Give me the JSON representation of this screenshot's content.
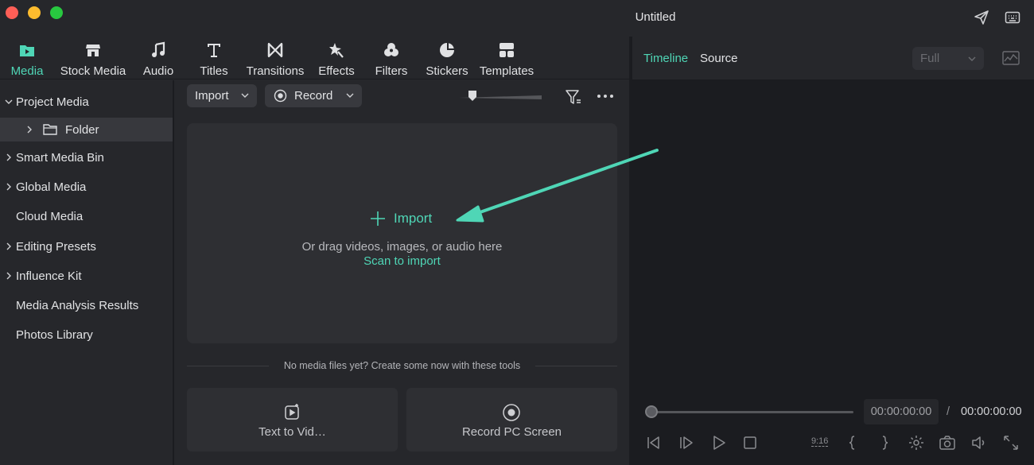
{
  "window": {
    "title": "Untitled"
  },
  "tabs": [
    {
      "label": "Media",
      "icon": "media-folder-icon",
      "active": true
    },
    {
      "label": "Stock Media",
      "icon": "stock-media-icon"
    },
    {
      "label": "Audio",
      "icon": "music-note-icon"
    },
    {
      "label": "Titles",
      "icon": "text-t-icon"
    },
    {
      "label": "Transitions",
      "icon": "transition-bowtie-icon"
    },
    {
      "label": "Effects",
      "icon": "effects-sparkle-icon"
    },
    {
      "label": "Filters",
      "icon": "filters-circles-icon"
    },
    {
      "label": "Stickers",
      "icon": "sticker-icon"
    },
    {
      "label": "Templates",
      "icon": "templates-grid-icon"
    }
  ],
  "sidebar": {
    "items": [
      {
        "label": "Project Media",
        "expander": "down"
      },
      {
        "label": "Folder",
        "expander": "right",
        "selected": true
      },
      {
        "label": "Smart Media Bin",
        "expander": "right"
      },
      {
        "label": "Global Media",
        "expander": "right"
      },
      {
        "label": "Cloud Media",
        "expander": ""
      },
      {
        "label": "Editing Presets",
        "expander": "right"
      },
      {
        "label": "Influence Kit",
        "expander": "right"
      },
      {
        "label": "Media Analysis Results",
        "expander": ""
      },
      {
        "label": "Photos Library",
        "expander": ""
      }
    ]
  },
  "toolbar": {
    "import_label": "Import",
    "record_label": "Record"
  },
  "dropzone": {
    "import_label": "Import",
    "drag_text": "Or drag videos, images, or audio here",
    "scan_label": "Scan to import"
  },
  "tools": {
    "caption": "No media files yet? Create some now with these tools",
    "cards": [
      {
        "label": "Text to Vid…",
        "icon": "text-to-video-icon"
      },
      {
        "label": "Record PC Screen",
        "icon": "record-screen-icon"
      }
    ]
  },
  "preview": {
    "tabs": [
      {
        "label": "Timeline",
        "active": true
      },
      {
        "label": "Source",
        "active": false
      }
    ],
    "quality": "Full",
    "current_time": "00:00:00:00",
    "separator": "/",
    "total_time": "00:00:00:00",
    "ratio_label": "9:16"
  },
  "colors": {
    "accent": "#4fd6b6",
    "panel": "#26272b",
    "background": "#1b1c20"
  }
}
